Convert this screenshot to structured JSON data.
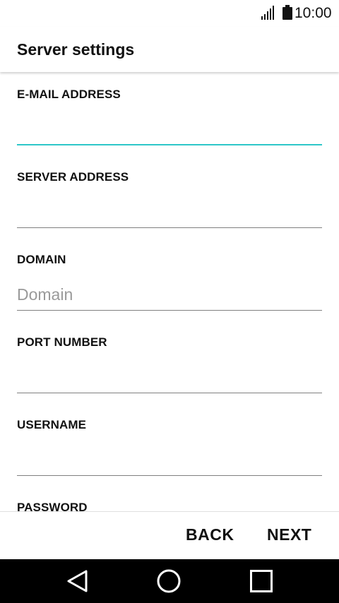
{
  "status_bar": {
    "time": "10:00",
    "signal_icon": "signal-icon",
    "battery_icon": "battery-icon"
  },
  "header": {
    "title": "Server settings"
  },
  "form": {
    "fields": [
      {
        "label": "E-MAIL ADDRESS",
        "value": "",
        "placeholder": "",
        "focused": true
      },
      {
        "label": "SERVER ADDRESS",
        "value": "",
        "placeholder": ""
      },
      {
        "label": "DOMAIN",
        "value": "",
        "placeholder": "Domain"
      },
      {
        "label": "PORT NUMBER",
        "value": "",
        "placeholder": ""
      },
      {
        "label": "USERNAME",
        "value": "",
        "placeholder": ""
      },
      {
        "label": "PASSWORD",
        "value": "",
        "placeholder": ""
      }
    ]
  },
  "footer": {
    "back_label": "BACK",
    "next_label": "NEXT"
  },
  "nav_bar": {
    "icons": [
      "back-triangle-icon",
      "home-circle-icon",
      "recents-square-icon"
    ]
  },
  "colors": {
    "accent": "#2ec7c9",
    "divider": "#808080",
    "nav_background": "#000000"
  }
}
